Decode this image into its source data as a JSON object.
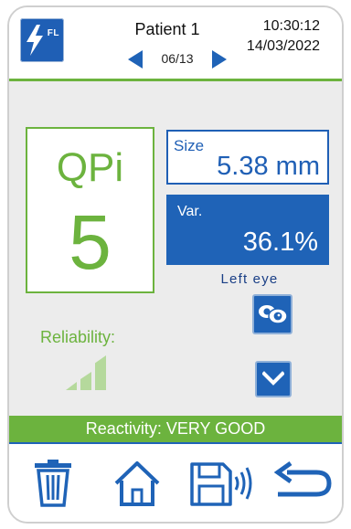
{
  "header": {
    "logo_text": "FL",
    "patient_name": "Patient 1",
    "page_indicator": "06/13",
    "time": "10:30:12",
    "date": "14/03/2022"
  },
  "qpi": {
    "label": "QPi",
    "value": "5"
  },
  "size": {
    "label": "Size",
    "value": "5.38 mm"
  },
  "variation": {
    "label": "Var.",
    "value": "36.1%"
  },
  "eye": {
    "label": "Left eye"
  },
  "reliability": {
    "label": "Reliability:",
    "level": 3,
    "max_level": 3
  },
  "reactivity": {
    "text": "Reactivity: VERY GOOD"
  },
  "colors": {
    "accent_blue": "#1f63b7",
    "accent_green": "#6cb33e",
    "background_gray": "#ececec"
  },
  "icons": {
    "logo": "lightning-bolt-icon",
    "prev": "triangle-left-icon",
    "next": "triangle-right-icon",
    "eye_toggle": "eyes-icon",
    "expand": "chevron-down-icon",
    "delete": "trash-icon",
    "home": "home-icon",
    "save": "save-transmit-icon",
    "back": "return-arrow-icon"
  }
}
